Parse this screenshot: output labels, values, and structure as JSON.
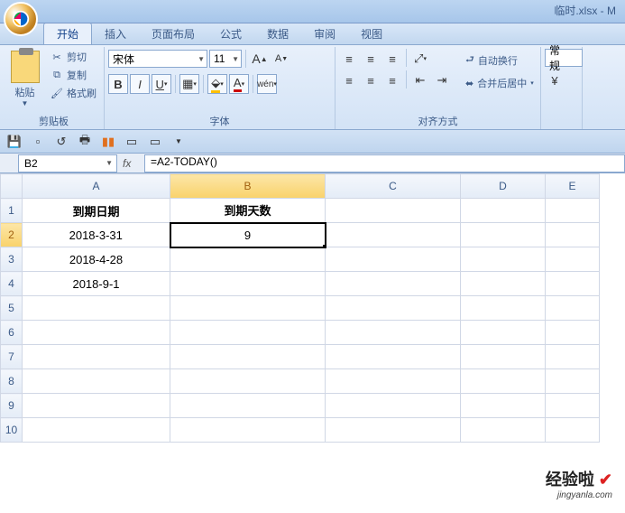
{
  "title": "临时.xlsx - M",
  "tabs": [
    "开始",
    "插入",
    "页面布局",
    "公式",
    "数据",
    "审阅",
    "视图"
  ],
  "active_tab": 0,
  "clipboard": {
    "paste": "粘贴",
    "cut": "剪切",
    "copy": "复制",
    "format_painter": "格式刷",
    "group": "剪贴板"
  },
  "font": {
    "name": "宋体",
    "size": "11",
    "group": "字体"
  },
  "align": {
    "wrap": "自动换行",
    "merge": "合并后居中",
    "group": "对齐方式"
  },
  "number": {
    "format": "常规"
  },
  "namebox": "B2",
  "formula": "=A2-TODAY()",
  "fx": "fx",
  "columns": [
    "A",
    "B",
    "C",
    "D",
    "E"
  ],
  "rows": [
    "1",
    "2",
    "3",
    "4",
    "5",
    "6",
    "7",
    "8",
    "9",
    "10"
  ],
  "cells": {
    "A1": "到期日期",
    "B1": "到期天数",
    "A2": "2018-3-31",
    "B2": "9",
    "A3": "2018-4-28",
    "A4": "2018-9-1"
  },
  "selected": "B2",
  "watermark": {
    "l1a": "经验啦",
    "l1b": "✔",
    "l2": "jingyanla.com"
  }
}
